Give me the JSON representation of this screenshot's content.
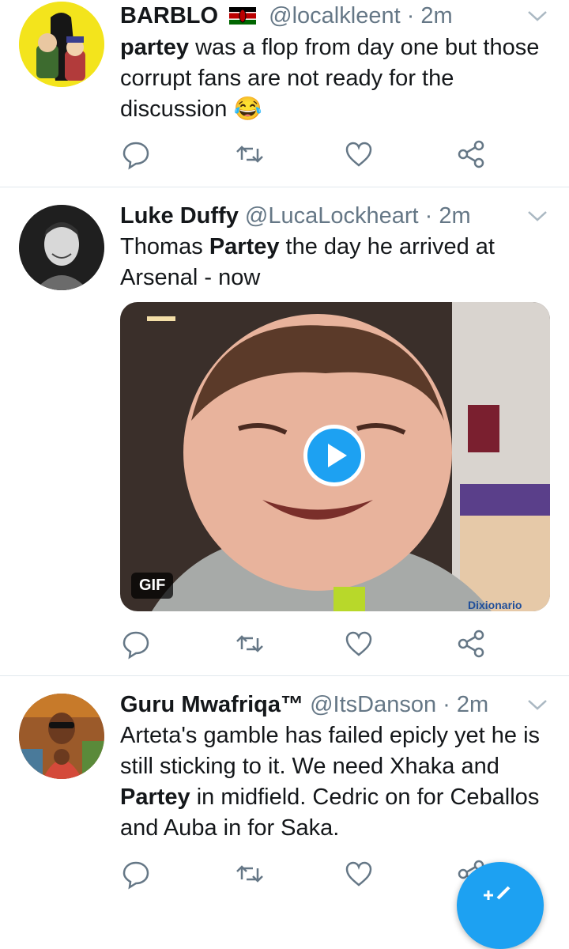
{
  "tweets": [
    {
      "name": "BARBLO",
      "flag": "kenya-flag",
      "handle": "@localkleent",
      "time": "· 2m",
      "text_parts": [
        {
          "bold": true,
          "t": "partey"
        },
        {
          "bold": false,
          "t": " was a flop from day one but those corrupt fans are not ready for the discussion "
        },
        {
          "bold": false,
          "t": "😂"
        }
      ]
    },
    {
      "name": "Luke Duffy",
      "handle": "@LucaLockheart",
      "time": "· 2m",
      "text_parts": [
        {
          "bold": false,
          "t": "Thomas "
        },
        {
          "bold": true,
          "t": "Partey"
        },
        {
          "bold": false,
          "t": " the day he arrived at Arsenal - now"
        }
      ],
      "media": {
        "badge": "GIF",
        "watermark": "Dixionario"
      }
    },
    {
      "name": "Guru Mwafriqa™",
      "handle": "@ItsDanson",
      "time": "· 2m",
      "text_parts": [
        {
          "bold": false,
          "t": "Arteta's gamble has failed epicly yet he is still sticking to it. We need Xhaka and "
        },
        {
          "bold": true,
          "t": "Partey"
        },
        {
          "bold": false,
          "t": " in midfield. Cedric on for Ceballos and Auba in for Saka."
        }
      ]
    }
  ],
  "icons": {
    "reply": "reply-icon",
    "retweet": "retweet-icon",
    "like": "heart-icon",
    "share": "share-icon",
    "more": "chevron-down-icon",
    "compose": "compose-tweet-icon"
  },
  "colors": {
    "accent": "#1da1f2",
    "muted": "#657786",
    "divider": "#e1e8ed"
  }
}
